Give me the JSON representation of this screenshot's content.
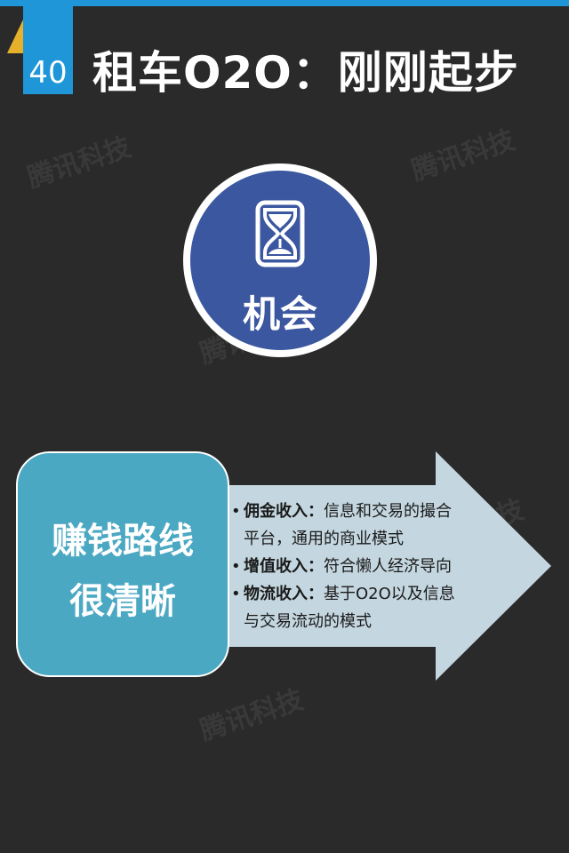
{
  "header": {
    "number": "40",
    "title": "租车O2O：刚刚起步"
  },
  "watermark_text": "腾讯科技",
  "circle": {
    "icon": "hourglass-icon",
    "label": "机会"
  },
  "box": {
    "lines": [
      "赚钱路线",
      "很清晰"
    ]
  },
  "bullets": [
    {
      "lead": "佣金收入：",
      "lines": [
        "信息和交易的撮合",
        "平台，通用的商业模式"
      ]
    },
    {
      "lead": "增值收入：",
      "lines": [
        "符合懒人经济导向"
      ]
    },
    {
      "lead": "物流收入：",
      "lines": [
        "基于O2O以及信息",
        "与交易流动的模式"
      ]
    }
  ],
  "colors": {
    "background": "#2a2a2a",
    "accent_blue": "#1e96d8",
    "circle_fill": "#3b57a0",
    "box_fill": "#4ba8c2",
    "arrow_fill": "#c4d6df",
    "corner_yellow": "#e7b02a"
  }
}
